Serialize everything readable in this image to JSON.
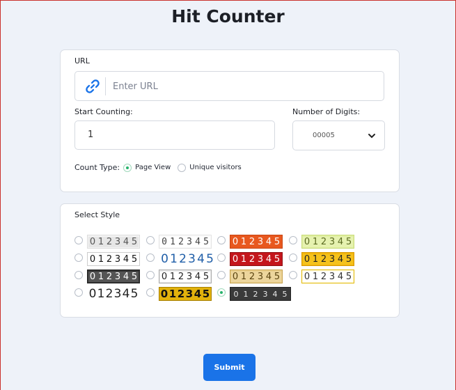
{
  "page": {
    "title": "Hit Counter"
  },
  "form": {
    "url_label": "URL",
    "url_placeholder": "Enter URL",
    "start_label": "Start Counting:",
    "start_value": "1",
    "digits_label": "Number of Digits:",
    "digits_value": "00005",
    "count_type_label": "Count Type:",
    "count_type_options": [
      "Page View",
      "Unique visitors"
    ],
    "count_type_selected": 0
  },
  "styles": {
    "label": "Select Style",
    "digits": "012345",
    "selected_index": 14,
    "items": [
      {
        "id": "s1"
      },
      {
        "id": "s2"
      },
      {
        "id": "s3"
      },
      {
        "id": "s4"
      },
      {
        "id": "s5"
      },
      {
        "id": "s6"
      },
      {
        "id": "s7"
      },
      {
        "id": "s8"
      },
      {
        "id": "s9"
      },
      {
        "id": "s10"
      },
      {
        "id": "s11"
      },
      {
        "id": "s12"
      },
      {
        "id": "s13"
      },
      {
        "id": "s14"
      },
      {
        "id": "s15"
      }
    ]
  },
  "actions": {
    "submit_label": "Submit"
  },
  "colors": {
    "accent": "#1a73e8",
    "radio_selected": "#27b36b",
    "page_bg": "#eef2f9"
  },
  "icons": {
    "url_icon": "link-icon",
    "digits_chevron": "chevron-down-icon"
  }
}
